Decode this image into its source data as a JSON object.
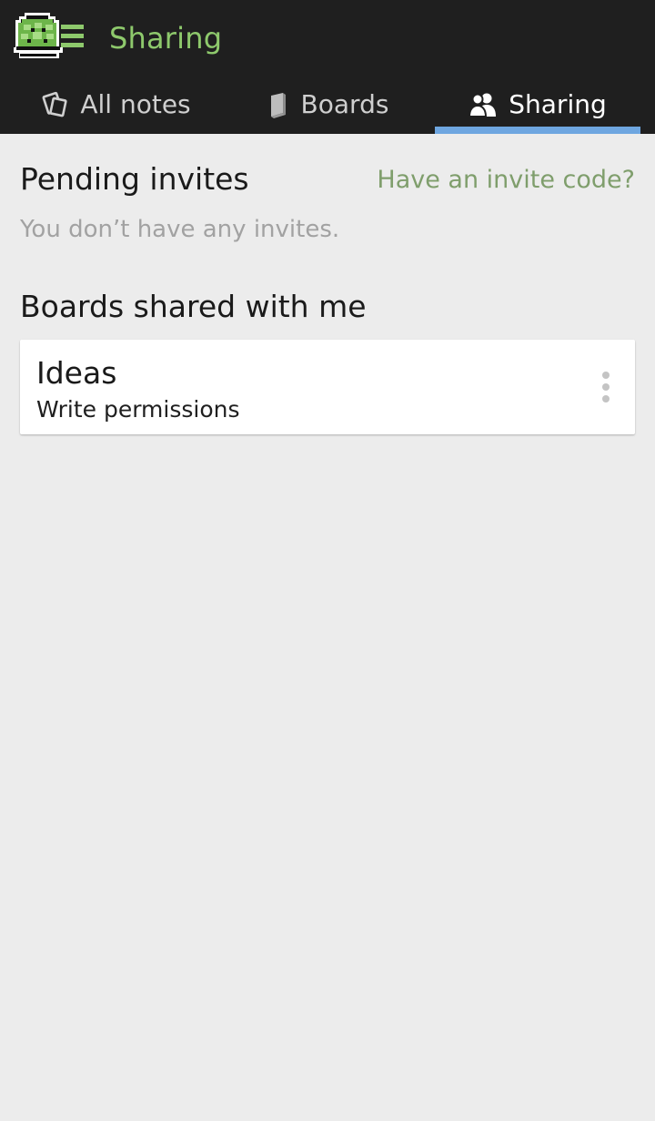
{
  "header": {
    "title": "Sharing",
    "logo_icon": "turtle-shell-menu-icon",
    "title_color": "#8ec96c",
    "background": "#1f1f1f"
  },
  "tabs": [
    {
      "label": "All notes",
      "icon": "notes-icon",
      "selected": false
    },
    {
      "label": "Boards",
      "icon": "book-icon",
      "selected": false
    },
    {
      "label": "Sharing",
      "icon": "people-icon",
      "selected": true
    }
  ],
  "accent_color": "#6ea6e0",
  "pending": {
    "title": "Pending invites",
    "invite_link": "Have an invite code?",
    "empty_text": "You don’t have any invites."
  },
  "shared": {
    "title": "Boards shared with me",
    "boards": [
      {
        "name": "Ideas",
        "permissions": "Write permissions",
        "menu_icon": "more-vert-icon"
      }
    ]
  }
}
